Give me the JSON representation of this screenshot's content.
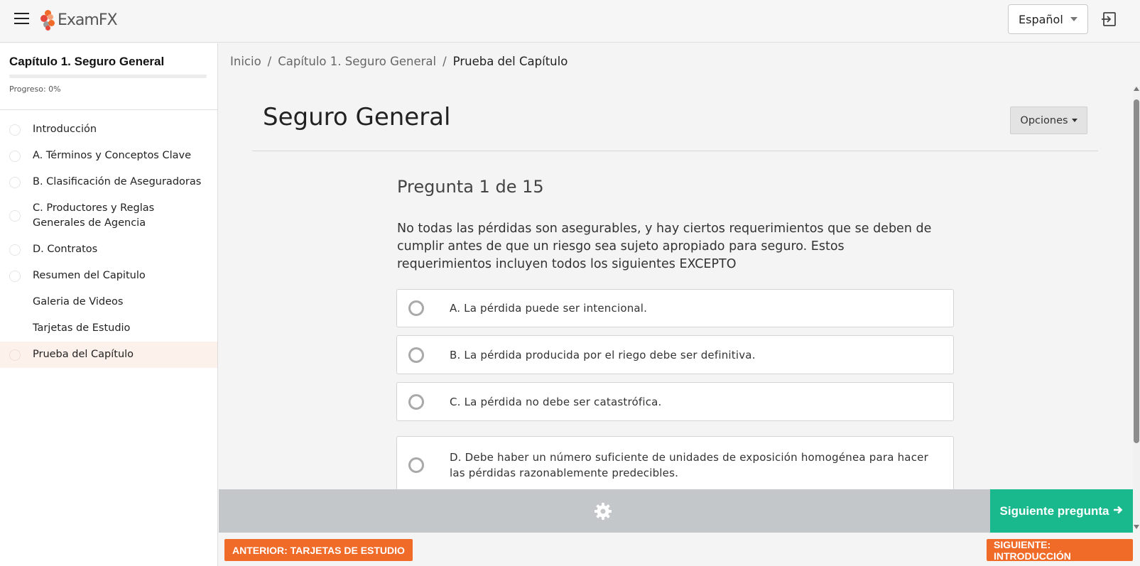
{
  "header": {
    "menu_icon": "hamburger-menu-icon",
    "logo_text": "ExamFX",
    "language": "Español",
    "exit_icon": "sign-out-icon",
    "colors": {
      "logo_orange": "#f06a28",
      "logo_red": "#e5483a",
      "logo_gray": "#9a9a9a"
    }
  },
  "sidebar": {
    "chapter_title": "Capítulo 1. Seguro General",
    "progress_label": "Progreso: 0%",
    "progress_value": 0,
    "items": [
      {
        "label": "Introducción",
        "has_dot": true,
        "active": false
      },
      {
        "label": "A. Términos y Conceptos Clave",
        "has_dot": true,
        "active": false
      },
      {
        "label": "B. Clasificación de Aseguradoras",
        "has_dot": true,
        "active": false
      },
      {
        "label": "C. Productores y Reglas Generales de Agencia",
        "has_dot": true,
        "active": false
      },
      {
        "label": "D. Contratos",
        "has_dot": true,
        "active": false
      },
      {
        "label": "Resumen del Capitulo",
        "has_dot": true,
        "active": false
      },
      {
        "label": "Galeria de Videos",
        "has_dot": false,
        "active": false
      },
      {
        "label": "Tarjetas de Estudio",
        "has_dot": false,
        "active": false
      },
      {
        "label": "Prueba del Capítulo",
        "has_dot": true,
        "active": true
      }
    ]
  },
  "breadcrumb": {
    "items": [
      "Inicio",
      "Capítulo 1. Seguro General",
      "Prueba del Capítulo"
    ]
  },
  "main": {
    "title": "Seguro General",
    "options_label": "Opciones",
    "question_number": "Pregunta 1 de 15",
    "question_text": "No todas las pérdidas son asegurables, y hay ciertos requerimientos que se deben de cumplir antes de que un riesgo sea sujeto apropiado para seguro. Estos requerimientos incluyen todos los siguientes EXCEPTO",
    "choices": [
      "A. La pérdida puede ser intencional.",
      "B. La pérdida producida por el riego debe ser definitiva.",
      "C. La pérdida no debe ser catastrófica.",
      "D. Debe haber un número suficiente de unidades de exposición homogénea para hacer las pérdidas razonablemente predecibles."
    ]
  },
  "action_bar": {
    "settings_icon": "gear-icon",
    "next_question_label": "Siguiente pregunta",
    "next_question_icon": "arrow-right-icon",
    "colors": {
      "bar": "#c4c7ca",
      "next": "#19b98d"
    }
  },
  "footer_nav": {
    "prev_label": "ANTERIOR: TARJETAS DE ESTUDIO",
    "next_label": "SIGUIENTE: INTRODUCCIÓN",
    "color": "#f06a28"
  }
}
